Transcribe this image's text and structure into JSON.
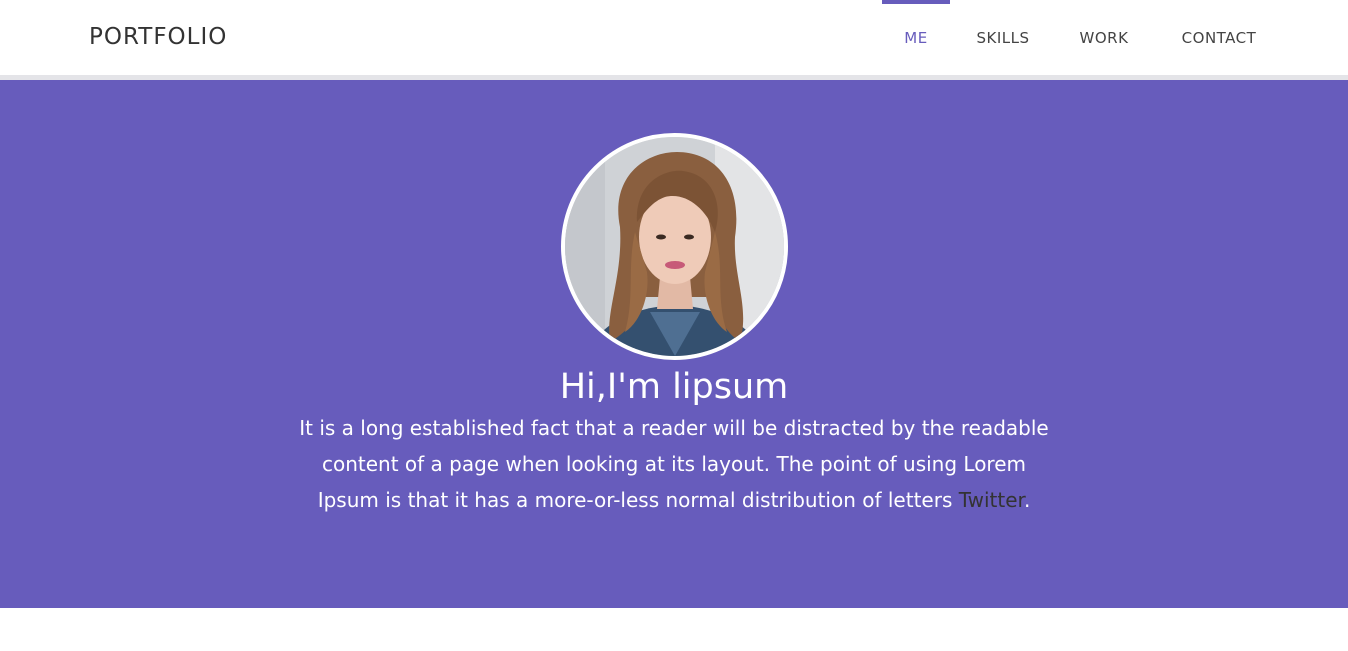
{
  "header": {
    "brand": "PORTFOLIO",
    "nav": [
      {
        "label": "ME",
        "active": true
      },
      {
        "label": "SKILLS",
        "active": false
      },
      {
        "label": "WORK",
        "active": false
      },
      {
        "label": "CONTACT",
        "active": false
      }
    ]
  },
  "hero": {
    "title": "Hi,I'm lipsum",
    "text": "It is a long established fact that a reader will be distracted by the readable content of a page when looking at its layout. The point of using Lorem Ipsum is that it has a more-or-less normal distribution of letters",
    "link_label": "Twitter",
    "end_punct": "."
  },
  "colors": {
    "accent": "#675cbc",
    "nav_text": "#444444",
    "brand_text": "#333333",
    "hero_text": "#ffffff",
    "link_text": "#333333"
  },
  "icons": {
    "avatar": "profile-photo"
  }
}
